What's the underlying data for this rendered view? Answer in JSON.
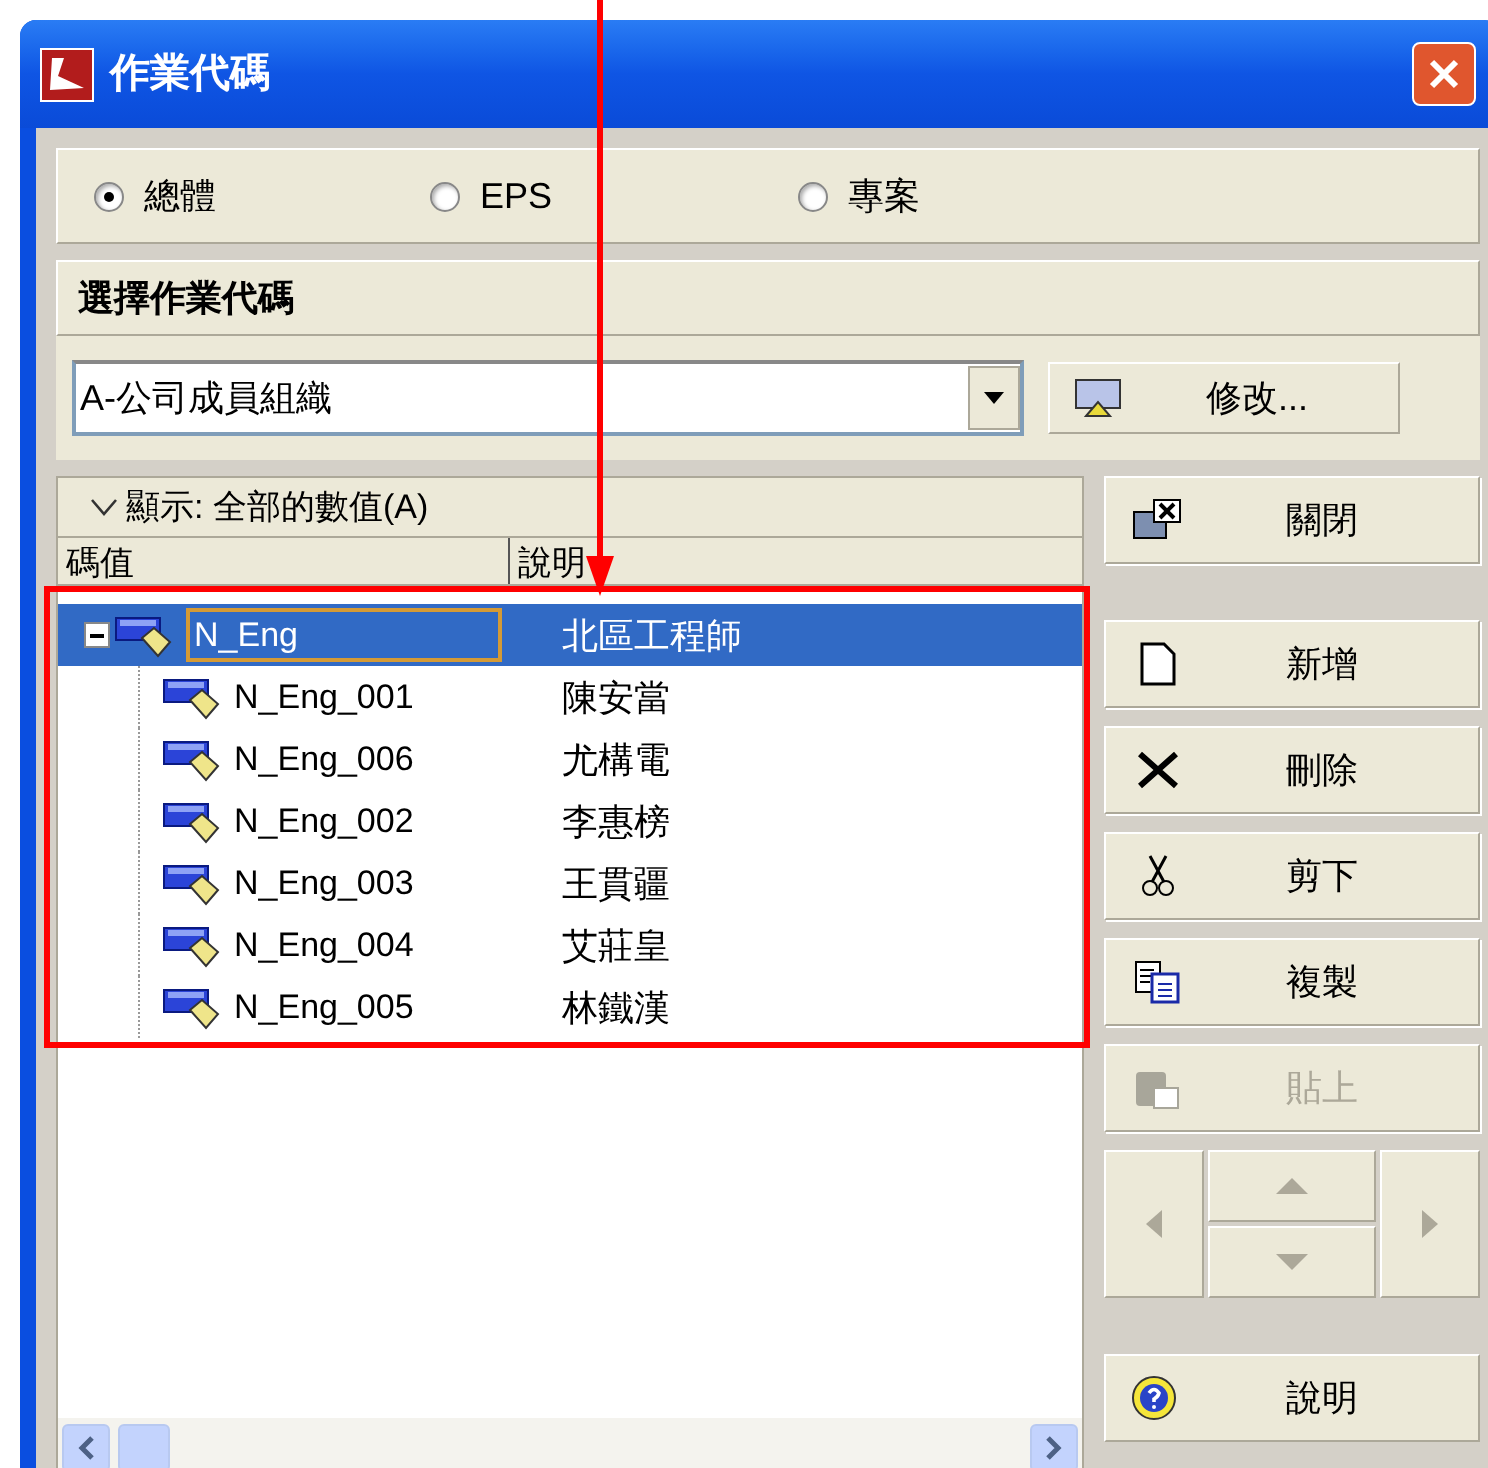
{
  "window": {
    "title": "作業代碼"
  },
  "scope_options": [
    {
      "label": "總體",
      "selected": true
    },
    {
      "label": "EPS",
      "selected": false
    },
    {
      "label": "專案",
      "selected": false
    }
  ],
  "section_title": "選擇作業代碼",
  "code_select": {
    "value": "A-公司成員組織"
  },
  "modify_button": {
    "label": "修改..."
  },
  "filter": {
    "label": "顯示: 全部的數值(A)",
    "expanded": true
  },
  "columns": [
    "碼值",
    "說明"
  ],
  "tree": [
    {
      "code": "N_Eng",
      "description": "北區工程師",
      "selected": true,
      "expanded": true,
      "children": [
        {
          "code": "N_Eng_001",
          "description": "陳安當",
          "selected": false
        },
        {
          "code": "N_Eng_006",
          "description": "尤構電",
          "selected": false
        },
        {
          "code": "N_Eng_002",
          "description": "李惠榜",
          "selected": false
        },
        {
          "code": "N_Eng_003",
          "description": "王貫疆",
          "selected": false
        },
        {
          "code": "N_Eng_004",
          "description": "艾莊皇",
          "selected": false
        },
        {
          "code": "N_Eng_005",
          "description": "林鐵漢",
          "selected": false
        }
      ]
    }
  ],
  "buttons": [
    {
      "kind": "close",
      "label": "關閉",
      "disabled": false
    },
    {
      "kind": "new",
      "label": "新增",
      "disabled": false
    },
    {
      "kind": "delete",
      "label": "刪除",
      "disabled": false
    },
    {
      "kind": "cut",
      "label": "剪下",
      "disabled": false
    },
    {
      "kind": "copy",
      "label": "複製",
      "disabled": false
    },
    {
      "kind": "paste",
      "label": "貼上",
      "disabled": true
    }
  ],
  "help_button": {
    "label": "說明"
  }
}
